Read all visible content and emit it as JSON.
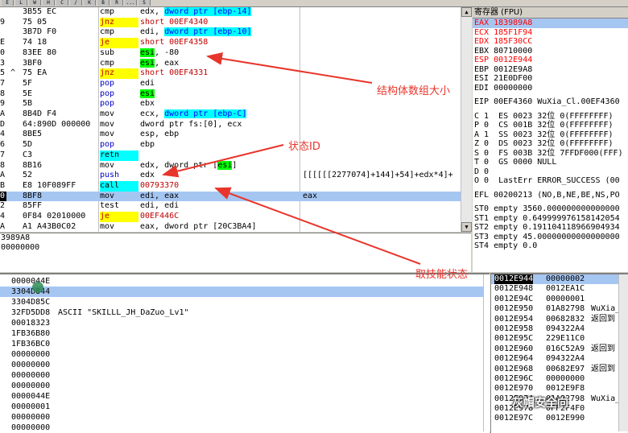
{
  "toolbar": {
    "buttons": [
      "E",
      "L",
      "W",
      "H",
      "C",
      "/",
      "K",
      "B",
      "R",
      "...",
      "S"
    ]
  },
  "disasm": {
    "rows": [
      {
        "addr": "",
        "mark": "",
        "hex": "3B55 EC",
        "mn": "cmp",
        "ops": "edx, dword ptr [ebp-14]",
        "comment": "",
        "selected": false
      },
      {
        "addr": "9",
        "mark": "",
        "hex": "75 05",
        "mn": "jnz",
        "ops": "short 00EF4340",
        "comment": "",
        "selected": false
      },
      {
        "addr": "",
        "mark": "",
        "hex": "3B7D F0",
        "mn": "cmp",
        "ops": "edi, dword ptr [ebp-10]",
        "comment": "",
        "selected": false
      },
      {
        "addr": "E",
        "mark": "",
        "hex": "74 18",
        "mn": "je",
        "ops": "short 00EF4358",
        "comment": "",
        "selected": false
      },
      {
        "addr": "0",
        "mark": "",
        "hex": "83EE 80",
        "mn": "sub",
        "ops": "esi, -80",
        "comment": "",
        "selected": false
      },
      {
        "addr": "3",
        "mark": "",
        "hex": "3BF0",
        "mn": "cmp",
        "ops": "esi, eax",
        "comment": "",
        "selected": false
      },
      {
        "addr": "5",
        "mark": "^",
        "hex": "75 EA",
        "mn": "jnz",
        "ops": "short 00EF4331",
        "comment": "",
        "selected": false
      },
      {
        "addr": "7",
        "mark": "",
        "hex": "5F",
        "mn": "pop",
        "ops": "edi",
        "comment": "",
        "selected": false
      },
      {
        "addr": "8",
        "mark": "",
        "hex": "5E",
        "mn": "pop",
        "ops": "esi",
        "comment": "",
        "selected": false
      },
      {
        "addr": "9",
        "mark": "",
        "hex": "5B",
        "mn": "pop",
        "ops": "ebx",
        "comment": "",
        "selected": false
      },
      {
        "addr": "A",
        "mark": "",
        "hex": "8B4D F4",
        "mn": "mov",
        "ops": "ecx, dword ptr [ebp-C]",
        "comment": "",
        "selected": false
      },
      {
        "addr": "D",
        "mark": "",
        "hex": "64:890D 000000",
        "mn": "mov",
        "ops": "dword ptr fs:[0], ecx",
        "comment": "",
        "selected": false
      },
      {
        "addr": "4",
        "mark": "",
        "hex": "8BE5",
        "mn": "mov",
        "ops": "esp, ebp",
        "comment": "",
        "selected": false
      },
      {
        "addr": "6",
        "mark": "",
        "hex": "5D",
        "mn": "pop",
        "ops": "ebp",
        "comment": "",
        "selected": false
      },
      {
        "addr": "7",
        "mark": "",
        "hex": "C3",
        "mn": "retn",
        "ops": "",
        "comment": "",
        "selected": false
      },
      {
        "addr": "8",
        "mark": "",
        "hex": "8B16",
        "mn": "mov",
        "ops": "edx, dword ptr [esi]",
        "comment": "",
        "selected": false
      },
      {
        "addr": "A",
        "mark": "",
        "hex": "52",
        "mn": "push",
        "ops": "edx",
        "comment": "[[[[[[2277074]+144]+54]+edx*4]+",
        "selected": false
      },
      {
        "addr": "B",
        "mark": "",
        "hex": "E8 10F089FF",
        "mn": "call",
        "ops": "00793370",
        "comment": "",
        "selected": false
      },
      {
        "addr": "0",
        "mark": "",
        "hex": "8BF8",
        "mn": "mov",
        "ops": "edi, eax",
        "comment": "eax",
        "selected": true
      },
      {
        "addr": "2",
        "mark": "",
        "hex": "85FF",
        "mn": "test",
        "ops": "edi, edi",
        "comment": "",
        "selected": false
      },
      {
        "addr": "4",
        "mark": "",
        "hex": "0F84 02010000",
        "mn": "je",
        "ops": "00EF446C",
        "comment": "",
        "selected": false
      },
      {
        "addr": "A",
        "mark": "",
        "hex": "A1 A43B0C02",
        "mn": "mov",
        "ops": "eax, dword ptr [20C3BA4]",
        "comment": "",
        "selected": false
      }
    ]
  },
  "info": {
    "lines": [
      "3989A8",
      "00000000"
    ]
  },
  "registers": {
    "title": "寄存器 (FPU)",
    "lines": [
      {
        "text": "EAX 183989A8",
        "red": true,
        "sel": true
      },
      {
        "text": "ECX 185F1F94",
        "red": true,
        "sel": false
      },
      {
        "text": "EDX 185F30CC",
        "red": true,
        "sel": false
      },
      {
        "text": "EBX 80710000",
        "red": false,
        "sel": false
      },
      {
        "text": "ESP 0012E944",
        "red": true,
        "sel": false
      },
      {
        "text": "EBP 0012E9A8",
        "red": false,
        "sel": false
      },
      {
        "text": "ESI 21E0DF00",
        "red": false,
        "sel": false
      },
      {
        "text": "EDI 00000000",
        "red": false,
        "sel": false
      },
      {
        "text": "",
        "red": false,
        "sel": false
      },
      {
        "text": "EIP 00EF4360 WuXia_Cl.00EF4360",
        "red": false,
        "sel": false
      },
      {
        "text": "",
        "red": false,
        "sel": false
      },
      {
        "text": "C 1  ES 0023 32位 0(FFFFFFFF)",
        "red": false,
        "sel": false
      },
      {
        "text": "P 0  CS 001B 32位 0(FFFFFFFF)",
        "red": false,
        "sel": false
      },
      {
        "text": "A 1  SS 0023 32位 0(FFFFFFFF)",
        "red": false,
        "sel": false
      },
      {
        "text": "Z 0  DS 0023 32位 0(FFFFFFFF)",
        "red": false,
        "sel": false
      },
      {
        "text": "S 0  FS 003B 32位 7FFDF000(FFF)",
        "red": false,
        "sel": false
      },
      {
        "text": "T 0  GS 0000 NULL",
        "red": false,
        "sel": false
      },
      {
        "text": "D 0",
        "red": false,
        "sel": false
      },
      {
        "text": "O 0  LastErr ERROR_SUCCESS (00",
        "red": false,
        "sel": false
      },
      {
        "text": "",
        "red": false,
        "sel": false
      },
      {
        "text": "EFL 00200213 (NO,B,NE,BE,NS,PO",
        "red": false,
        "sel": false
      },
      {
        "text": "",
        "red": false,
        "sel": false
      },
      {
        "text": "ST0 empty 3560.000000000000000",
        "red": false,
        "sel": false
      },
      {
        "text": "ST1 empty 0.649999976158142054",
        "red": false,
        "sel": false
      },
      {
        "text": "ST2 empty 0.191104118966904934",
        "red": false,
        "sel": false
      },
      {
        "text": "ST3 empty 45.00000000000000000",
        "red": false,
        "sel": false
      },
      {
        "text": "ST4 empty 0.0",
        "red": false,
        "sel": false
      }
    ]
  },
  "dump": {
    "rows": [
      {
        "a": "0000044E",
        "b": "",
        "sel": false
      },
      {
        "a": "3304D844",
        "b": "",
        "sel": true
      },
      {
        "a": "3304D85C",
        "b": "",
        "sel": false
      },
      {
        "a": "32FD5DD8",
        "b": "ASCII \"SKILLL_JH_DaZuo_Lv1\"",
        "sel": false
      },
      {
        "a": "00018323",
        "b": "",
        "sel": false
      },
      {
        "a": "1FB36B80",
        "b": "",
        "sel": false
      },
      {
        "a": "1FB36BC0",
        "b": "",
        "sel": false
      },
      {
        "a": "00000000",
        "b": "",
        "sel": false
      },
      {
        "a": "00000000",
        "b": "",
        "sel": false
      },
      {
        "a": "00000000",
        "b": "",
        "sel": false
      },
      {
        "a": "00000000",
        "b": "",
        "sel": false
      },
      {
        "a": "0000044E",
        "b": "",
        "sel": false
      },
      {
        "a": "00000001",
        "b": "",
        "sel": false
      },
      {
        "a": "00000000",
        "b": "",
        "sel": false
      },
      {
        "a": "00000000",
        "b": "",
        "sel": false
      }
    ]
  },
  "stack": {
    "rows": [
      {
        "addr": "0012E944",
        "val": "00000002",
        "cmt": "",
        "sel": true
      },
      {
        "addr": "0012E948",
        "val": "0012EA1C",
        "cmt": "",
        "sel": false
      },
      {
        "addr": "0012E94C",
        "val": "00000001",
        "cmt": "",
        "sel": false
      },
      {
        "addr": "0012E950",
        "val": "01A82798",
        "cmt": "WuXia_Cl",
        "sel": false
      },
      {
        "addr": "0012E954",
        "val": "00682832",
        "cmt": "返回到 W",
        "sel": false
      },
      {
        "addr": "0012E958",
        "val": "094322A4",
        "cmt": "",
        "sel": false
      },
      {
        "addr": "0012E95C",
        "val": "229E11C0",
        "cmt": "",
        "sel": false
      },
      {
        "addr": "0012E960",
        "val": "016C52A9",
        "cmt": "返回到 W",
        "sel": false
      },
      {
        "addr": "0012E964",
        "val": "094322A4",
        "cmt": "",
        "sel": false
      },
      {
        "addr": "0012E968",
        "val": "00682E97",
        "cmt": "返回到 W",
        "sel": false
      },
      {
        "addr": "0012E96C",
        "val": "00000000",
        "cmt": "",
        "sel": false
      },
      {
        "addr": "0012E970",
        "val": "0012E9F8",
        "cmt": "",
        "sel": false
      },
      {
        "addr": "0012E974",
        "val": "01A82798",
        "cmt": "WuXia_Cl",
        "sel": false
      },
      {
        "addr": "0012E978",
        "val": "0FF2F4F0",
        "cmt": "",
        "sel": false
      },
      {
        "addr": "0012E97C",
        "val": "0012E990",
        "cmt": "",
        "sel": false
      }
    ]
  },
  "annotations": {
    "struct_size": "结构体数组大小",
    "state_id": "状态ID",
    "get_skill": "取技能状态"
  },
  "watermark": "灰帽安全向",
  "colors": {
    "selection": "#a6c6f2",
    "annotation_red": "#e8352b",
    "jump_yellow": "#ffff00",
    "reg_highlight_green": "#00ff00",
    "call_cyan": "#00ffff"
  }
}
